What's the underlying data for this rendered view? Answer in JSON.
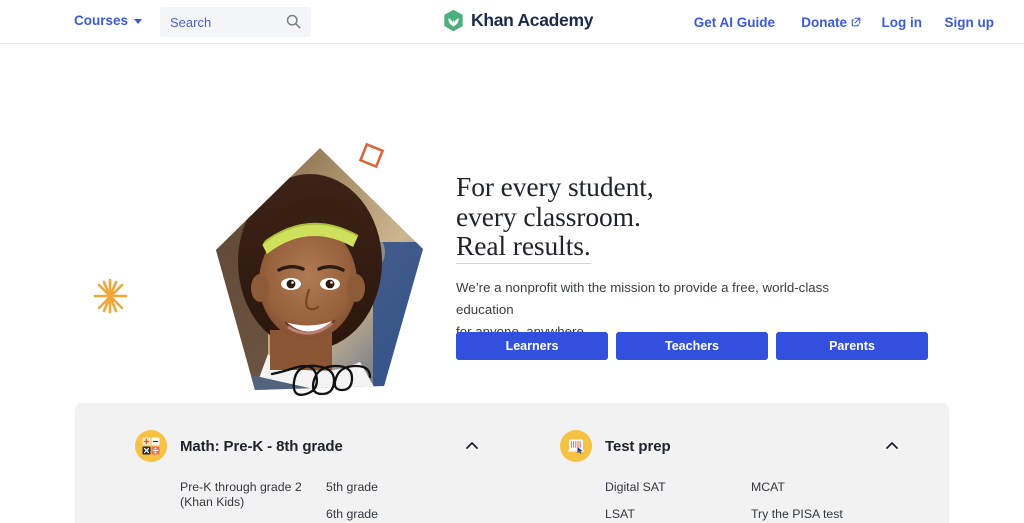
{
  "nav": {
    "courses_label": "Courses",
    "courses_icon": "chevron-down-icon",
    "search_placeholder": "Search",
    "search_value": "",
    "search_icon": "search-icon",
    "logo_text": "Khan Academy",
    "logo_icon": "khan-academy-leaf-logo",
    "links": [
      {
        "label": "Get AI Guide",
        "external": false
      },
      {
        "label": "Donate",
        "external": true,
        "icon": "external-link-icon"
      },
      {
        "label": "Log in",
        "external": false
      },
      {
        "label": "Sign up",
        "external": false
      }
    ]
  },
  "hero": {
    "headline_line1": "For every student,",
    "headline_line2": "every classroom.",
    "headline_line3": "Real results.",
    "subtext_line1": "We’re a nonprofit with the mission to provide a free, world-class education",
    "subtext_line2": "for anyone, anywhere.",
    "buttons": [
      {
        "label": "Learners"
      },
      {
        "label": "Teachers"
      },
      {
        "label": "Parents"
      }
    ],
    "image_alt": "Smiling student wearing a green headband in a classroom, cropped to a pentagon",
    "decorations": [
      {
        "name": "starburst-decoration",
        "color": "#f0a838"
      },
      {
        "name": "square-outline-decoration",
        "color": "#d9663f"
      },
      {
        "name": "scribble-decoration",
        "color": "#111111"
      }
    ]
  },
  "course_panel": {
    "categories": [
      {
        "title": "Math: Pre-K - 8th grade",
        "icon": "math-operators-icon",
        "expanded": true,
        "toggle_icon": "chevron-up-icon",
        "columns": [
          [
            "Pre-K through grade 2 (Khan Kids)"
          ],
          [
            "5th grade",
            "6th grade"
          ]
        ]
      },
      {
        "title": "Test prep",
        "icon": "test-sheet-icon",
        "expanded": true,
        "toggle_icon": "chevron-up-icon",
        "columns": [
          [
            "Digital SAT",
            "LSAT"
          ],
          [
            "MCAT",
            "Try the PISA test"
          ]
        ]
      }
    ]
  },
  "colors": {
    "brand_blue": "#3250dd",
    "link_blue": "#3b5ae0",
    "logo_green": "#4caf7d",
    "icon_gold": "#f5c243",
    "panel_bg": "#f2f2f2",
    "text_dark": "#21242c"
  }
}
